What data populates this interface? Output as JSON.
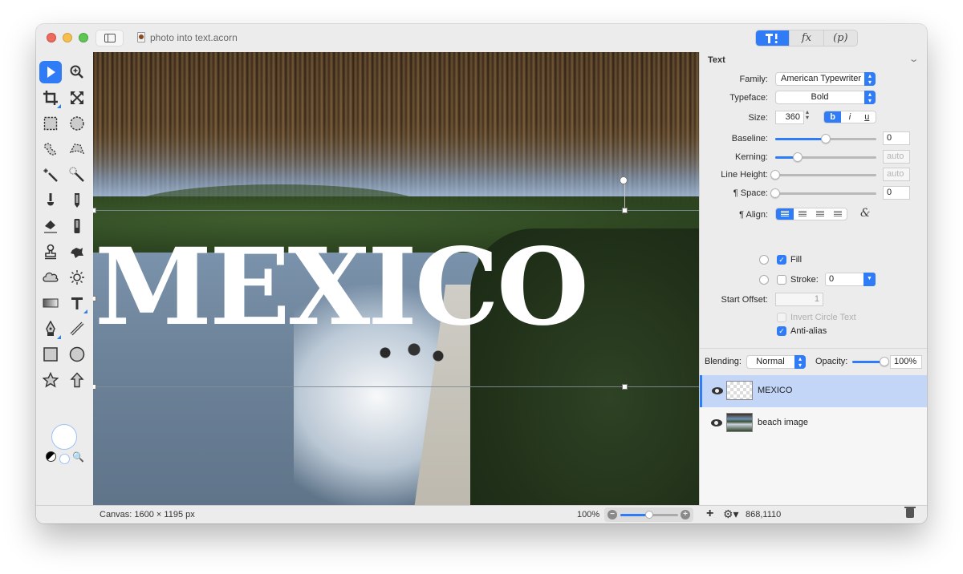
{
  "window": {
    "document_title": "photo into text.acorn",
    "inspector_tabs": [
      {
        "name": "tool-options",
        "label": "T!"
      },
      {
        "name": "effects",
        "label": "fx"
      },
      {
        "name": "properties",
        "label": "(p)"
      }
    ]
  },
  "tools": [
    {
      "name": "move-tool",
      "active": true
    },
    {
      "name": "zoom-tool"
    },
    {
      "name": "crop-tool"
    },
    {
      "name": "transform-tool"
    },
    {
      "name": "rect-select-tool"
    },
    {
      "name": "ellipse-select-tool"
    },
    {
      "name": "lasso-tool"
    },
    {
      "name": "polygon-lasso-tool"
    },
    {
      "name": "magic-wand-tool"
    },
    {
      "name": "instant-alpha-tool"
    },
    {
      "name": "brush-tool"
    },
    {
      "name": "pencil-tool"
    },
    {
      "name": "eraser-tool"
    },
    {
      "name": "smudge-tool"
    },
    {
      "name": "clone-tool"
    },
    {
      "name": "burn-tool"
    },
    {
      "name": "shape-tool"
    },
    {
      "name": "sun-tool"
    },
    {
      "name": "gradient-tool"
    },
    {
      "name": "text-tool"
    },
    {
      "name": "pen-tool"
    },
    {
      "name": "line-tool"
    },
    {
      "name": "rectangle-tool"
    },
    {
      "name": "oval-tool"
    },
    {
      "name": "star-tool"
    },
    {
      "name": "arrow-tool"
    }
  ],
  "canvas": {
    "text_layer_content": "MEXICO"
  },
  "inspector": {
    "section_title": "Text",
    "family_label": "Family:",
    "family_value": "American Typewriter",
    "typeface_label": "Typeface:",
    "typeface_value": "Bold",
    "size_label": "Size:",
    "size_value": "360",
    "style_buttons": {
      "bold": "b",
      "italic": "i",
      "underline": "u",
      "bold_active": true
    },
    "baseline_label": "Baseline:",
    "baseline_value": "0",
    "baseline_slider": 0.5,
    "kerning_label": "Kerning:",
    "kerning_value": "auto",
    "kerning_slider": 0.22,
    "line_height_label": "Line Height:",
    "line_height_value": "auto",
    "line_height_slider": 0.0,
    "space_label": "¶ Space:",
    "space_value": "0",
    "space_slider": 0.0,
    "align_label": "¶ Align:",
    "align_options": [
      "left",
      "center",
      "right",
      "justify"
    ],
    "align_selected": "left",
    "fill_label": "Fill",
    "fill_checked": true,
    "stroke_label": "Stroke:",
    "stroke_checked": false,
    "stroke_value": "0",
    "start_offset_label": "Start Offset:",
    "start_offset_value": "1",
    "invert_circle_label": "Invert Circle Text",
    "invert_circle_checked": false,
    "anti_alias_label": "Anti-alias",
    "anti_alias_checked": true
  },
  "layers_panel": {
    "blending_label": "Blending:",
    "blending_value": "Normal",
    "opacity_label": "Opacity:",
    "opacity_value": "100%",
    "opacity_slider": 1.0,
    "layers": [
      {
        "name": "MEXICO",
        "visible": true,
        "selected": true,
        "thumb": "transparent"
      },
      {
        "name": "beach image",
        "visible": true,
        "selected": false,
        "thumb": "beach"
      }
    ]
  },
  "statusbar": {
    "canvas_info": "Canvas: 1600 × 1195 px",
    "zoom_level": "100%",
    "zoom_slider": 0.5,
    "coordinates": "868,1110"
  }
}
